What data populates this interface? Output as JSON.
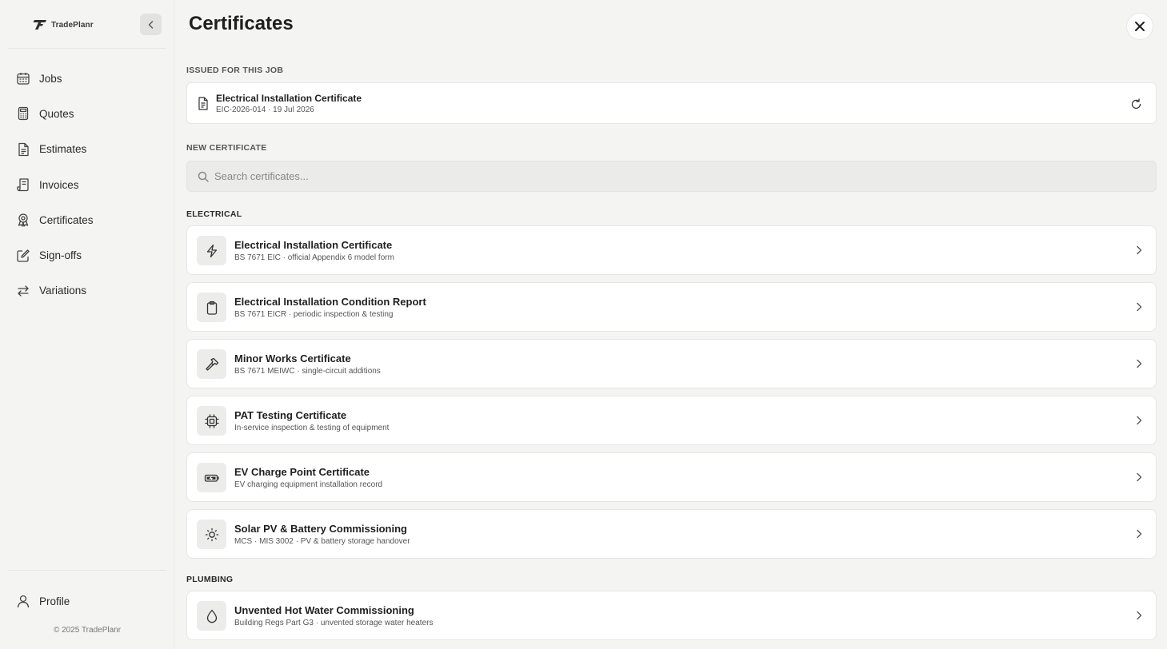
{
  "brand": {
    "name": "TradePlanr",
    "logo_icon": "tradeplanr-logo",
    "collapse_icon": "chevron-left-icon"
  },
  "sidebar": {
    "items": [
      {
        "label": "Jobs",
        "icon": "calendar-icon"
      },
      {
        "label": "Quotes",
        "icon": "calculator-icon"
      },
      {
        "label": "Estimates",
        "icon": "document-icon"
      },
      {
        "label": "Invoices",
        "icon": "receipt-icon"
      },
      {
        "label": "Certificates",
        "icon": "award-icon"
      },
      {
        "label": "Sign-offs",
        "icon": "edit-icon"
      },
      {
        "label": "Variations",
        "icon": "swap-arrows-icon"
      }
    ],
    "profile": {
      "label": "Profile",
      "icon": "user-icon"
    },
    "copyright": "© 2025 TradePlanr"
  },
  "main": {
    "title": "Certificates",
    "close_icon": "close-icon",
    "issued_label": "ISSUED FOR THIS JOB",
    "issued": {
      "title": "Electrical Installation Certificate",
      "subtitle": "EIC-2026-014 · 19 Jul 2026",
      "icon": "document-icon",
      "action_icon": "refresh-icon"
    },
    "new_label": "NEW CERTIFICATE",
    "search": {
      "placeholder": "Search certificates...",
      "value": "",
      "icon": "search-icon"
    },
    "groups": [
      {
        "label": "ELECTRICAL",
        "items": [
          {
            "title": "Electrical Installation Certificate",
            "subtitle": "BS 7671 EIC · official Appendix 6 model form",
            "icon": "lightning-icon"
          },
          {
            "title": "Electrical Installation Condition Report",
            "subtitle": "BS 7671 EICR · periodic inspection & testing",
            "icon": "clipboard-icon"
          },
          {
            "title": "Minor Works Certificate",
            "subtitle": "BS 7671 MEIWC · single-circuit additions",
            "icon": "hammer-icon"
          },
          {
            "title": "PAT Testing Certificate",
            "subtitle": "In-service inspection & testing of equipment",
            "icon": "chip-icon"
          },
          {
            "title": "EV Charge Point Certificate",
            "subtitle": "EV charging equipment installation record",
            "icon": "battery-charging-icon"
          },
          {
            "title": "Solar PV & Battery Commissioning",
            "subtitle": "MCS · MIS 3002 · PV & battery storage handover",
            "icon": "sun-icon"
          }
        ]
      },
      {
        "label": "PLUMBING",
        "items": [
          {
            "title": "Unvented Hot Water Commissioning",
            "subtitle": "Building Regs Part G3 · unvented storage water heaters",
            "icon": "droplet-icon"
          }
        ]
      }
    ]
  },
  "colors": {
    "background": "#f4f4f3",
    "card": "#ffffff",
    "border": "#e6e6e5",
    "text": "#1f1f1f",
    "muted": "#555555"
  }
}
